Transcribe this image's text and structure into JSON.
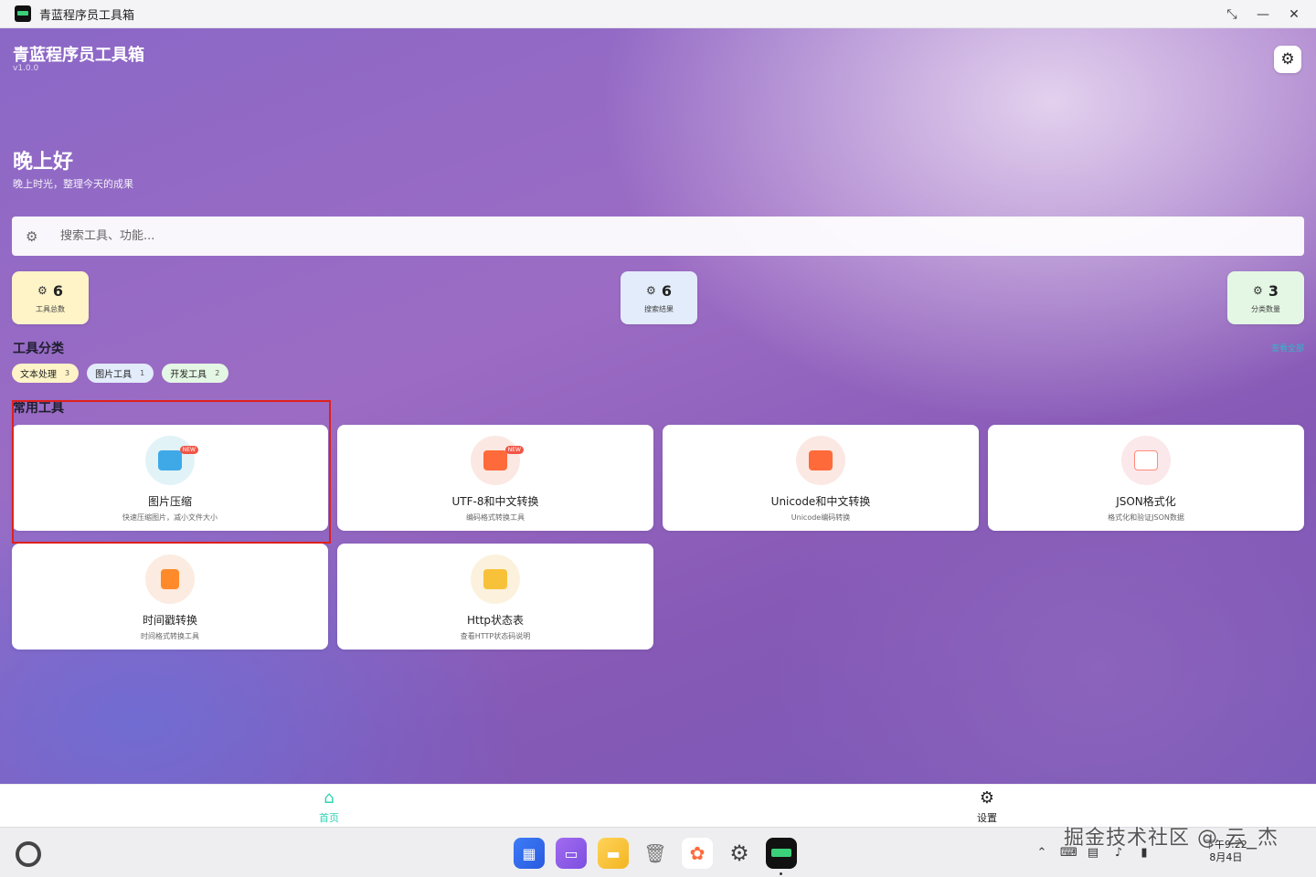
{
  "window": {
    "title": "青蓝程序员工具箱"
  },
  "header": {
    "title": "青蓝程序员工具箱",
    "version": "v1.0.0"
  },
  "greeting": {
    "title": "晚上好",
    "subtitle": "晚上时光，整理今天的成果"
  },
  "search": {
    "placeholder": "搜索工具、功能..."
  },
  "stats": [
    {
      "value": "6",
      "label": "工具总数",
      "color": "#fff4c8"
    },
    {
      "value": "6",
      "label": "搜索结果",
      "color": "#e3ecfb"
    },
    {
      "value": "3",
      "label": "分类数量",
      "color": "#e4f7e4"
    }
  ],
  "categories": {
    "title": "工具分类",
    "view_all": "查看全部",
    "items": [
      {
        "label": "文本处理",
        "count": "3"
      },
      {
        "label": "图片工具",
        "count": "1"
      },
      {
        "label": "开发工具",
        "count": "2"
      }
    ]
  },
  "common_tools": {
    "title": "常用工具",
    "items": [
      {
        "name": "图片压缩",
        "desc": "快速压缩图片，减小文件大小",
        "badge": "NEW",
        "icon": "image-icon",
        "color": "#3fa9e8"
      },
      {
        "name": "UTF-8和中文转换",
        "desc": "编码格式转换工具",
        "badge": "NEW",
        "icon": "convert-icon",
        "color": "#ff6a3a"
      },
      {
        "name": "Unicode和中文转换",
        "desc": "Unicode编码转换",
        "badge": "",
        "icon": "convert-icon",
        "color": "#ff6a3a"
      },
      {
        "name": "JSON格式化",
        "desc": "格式化和验证JSON数据",
        "badge": "",
        "icon": "json-file-icon",
        "color": "#ff8a7a"
      },
      {
        "name": "时间戳转换",
        "desc": "时间格式转换工具",
        "badge": "",
        "icon": "edit-document-icon",
        "color": "#ff8a2a"
      },
      {
        "name": "Http状态表",
        "desc": "查看HTTP状态码说明",
        "badge": "",
        "icon": "html-icon",
        "color": "#f7c23a"
      }
    ]
  },
  "bottom_nav": {
    "home": "首页",
    "settings": "设置"
  },
  "taskbar": {
    "time": "下午9:22",
    "date": "8月4日"
  },
  "watermark": "掘金技术社区 @ 云_杰"
}
